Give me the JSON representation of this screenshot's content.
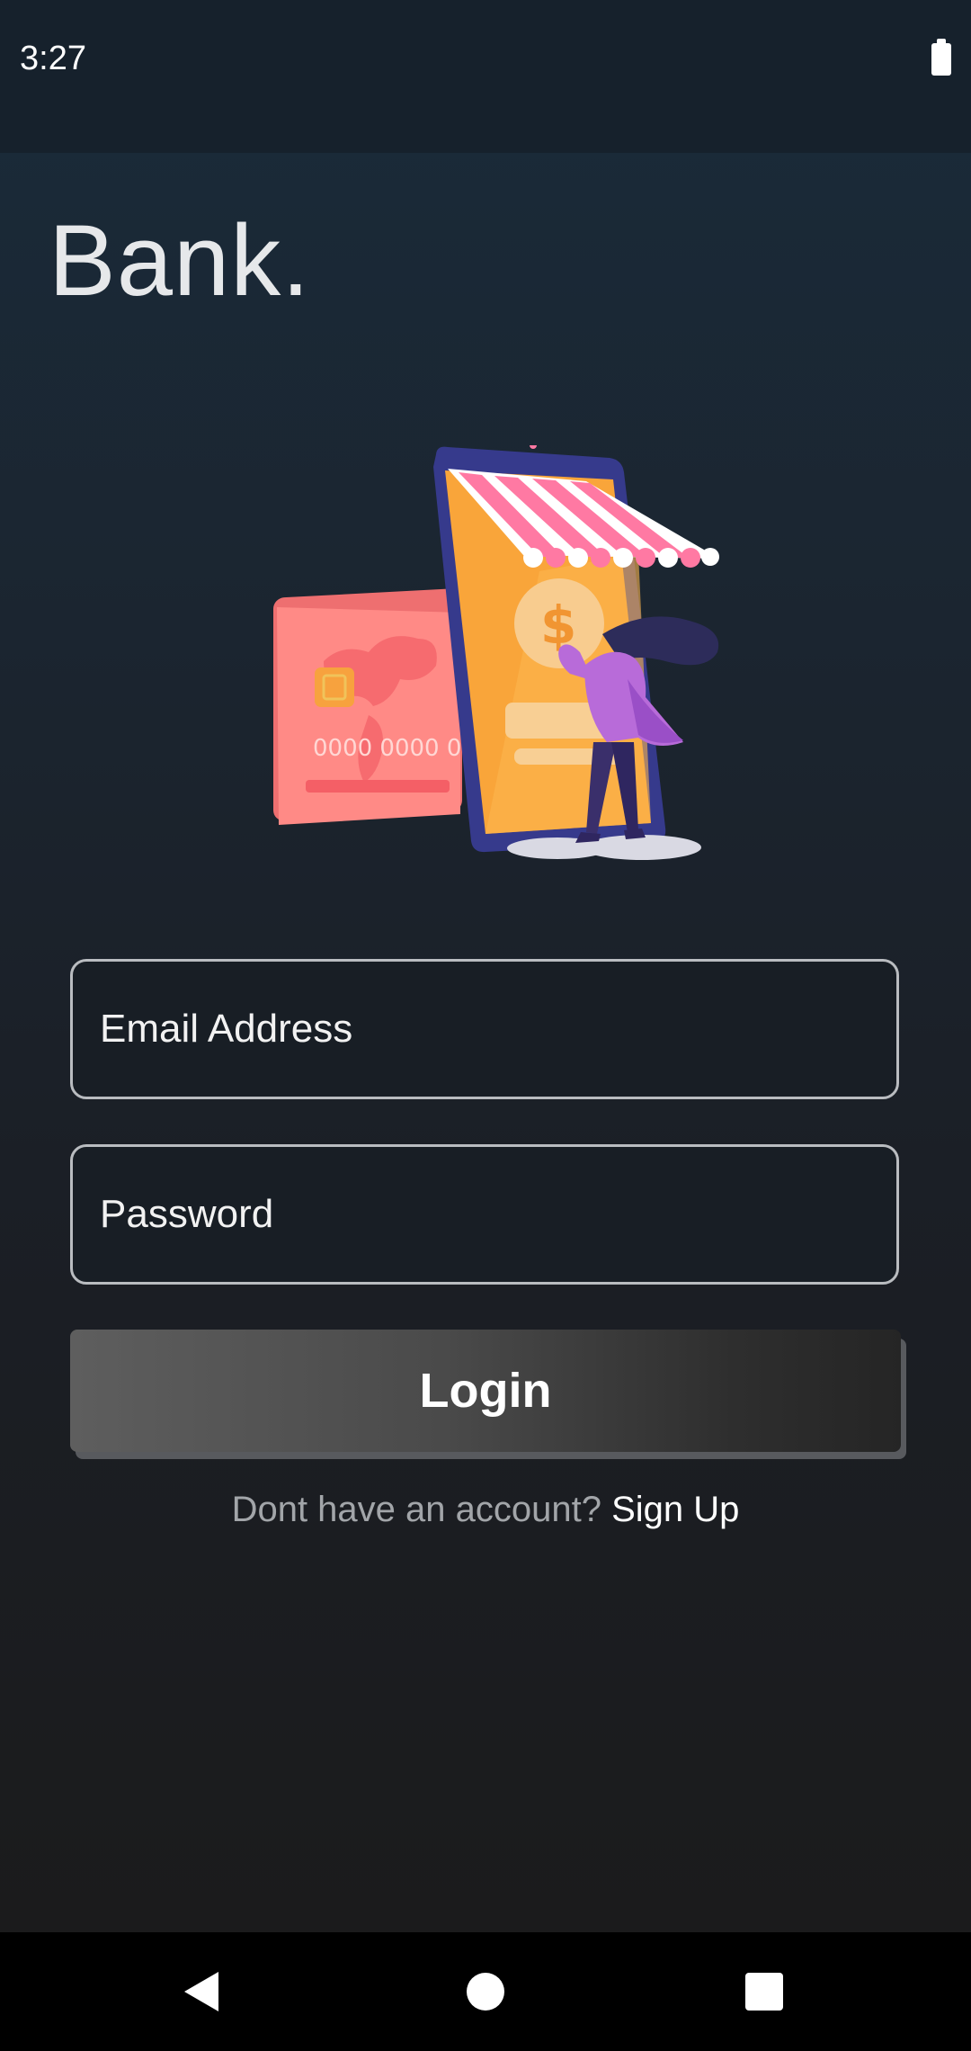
{
  "status_bar": {
    "time": "3:27",
    "battery_icon": "battery-full-icon"
  },
  "brand": {
    "title": "Bank."
  },
  "hero": {
    "icon": "bank-illustration",
    "card_number": "0000 0000 0",
    "coin_symbol": "$"
  },
  "form": {
    "email_placeholder": "Email Address",
    "password_placeholder": "Password",
    "login_label": "Login"
  },
  "signup": {
    "prompt": "Dont have an account? ",
    "link": "Sign Up"
  },
  "nav": {
    "back_icon": "back-triangle-icon",
    "home_icon": "home-circle-icon",
    "recents_icon": "recents-square-icon"
  },
  "colors": {
    "card": "#ff7f7c",
    "phone": "#f9a53a",
    "awning_pink": "#ff79a3",
    "person": "#b86bd9",
    "hair": "#2d2c5a"
  }
}
